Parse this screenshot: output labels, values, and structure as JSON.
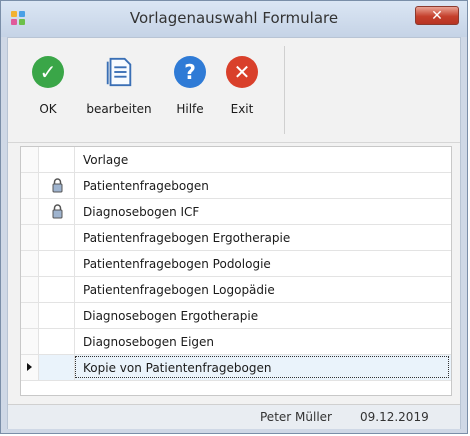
{
  "window": {
    "title": "Vorlagenauswahl Formulare",
    "close_glyph": "✕"
  },
  "toolbar": {
    "buttons": [
      {
        "label": "OK",
        "icon": "check-icon",
        "color": "#3aa648",
        "glyph": "✓"
      },
      {
        "label": "bearbeiten",
        "icon": "document-edit-icon",
        "color": "#3a6fb5",
        "glyph": ""
      },
      {
        "label": "Hilfe",
        "icon": "help-icon",
        "color": "#2f7bd6",
        "glyph": "?"
      },
      {
        "label": "Exit",
        "icon": "exit-icon",
        "color": "#d9402b",
        "glyph": "✕"
      }
    ]
  },
  "grid": {
    "header": "Vorlage",
    "rows": [
      {
        "name": "Patientenfragebogen",
        "locked": true
      },
      {
        "name": "Diagnosebogen ICF",
        "locked": true
      },
      {
        "name": "Patientenfragebogen Ergotherapie",
        "locked": false
      },
      {
        "name": "Patientenfragebogen Podologie",
        "locked": false
      },
      {
        "name": "Patientenfragebogen Logopädie",
        "locked": false
      },
      {
        "name": "Diagnosebogen Ergotherapie",
        "locked": false
      },
      {
        "name": "Diagnosebogen Eigen",
        "locked": false
      },
      {
        "name": "Kopie von Patientenfragebogen",
        "locked": false,
        "selected": true
      }
    ]
  },
  "status": {
    "user": "Peter Müller",
    "date": "09.12.2019"
  },
  "colors": {
    "accent": "#2f7bd6",
    "ok": "#3aa648",
    "exit": "#d9402b"
  }
}
